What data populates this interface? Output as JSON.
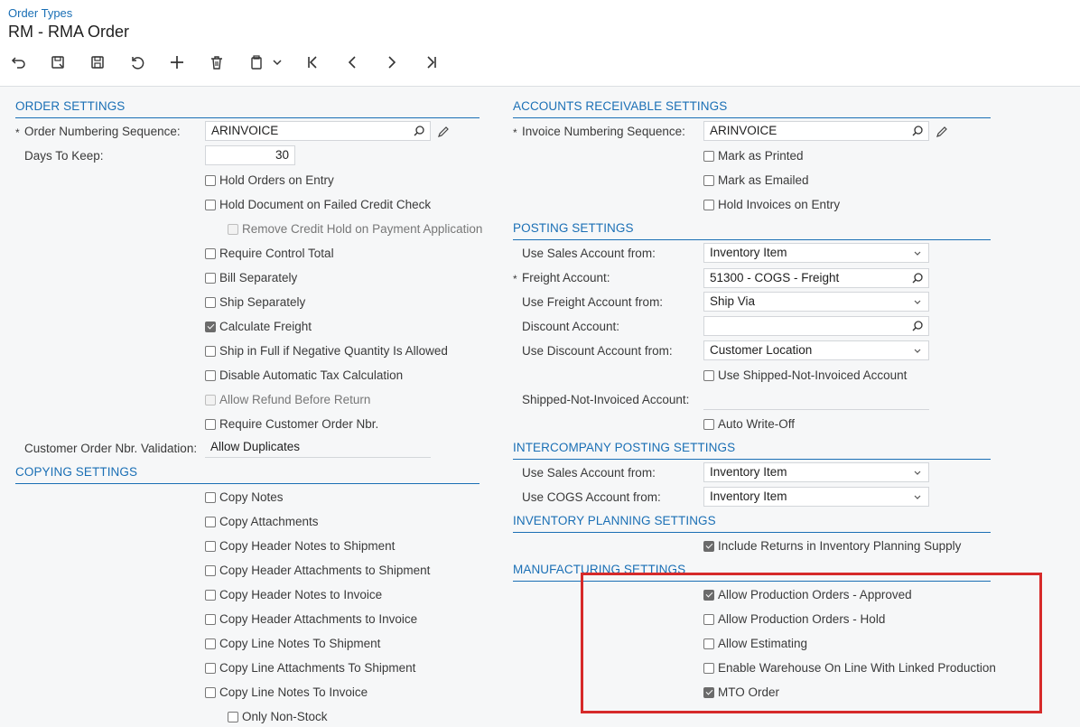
{
  "header": {
    "breadcrumb": "Order Types",
    "title": "RM - RMA Order"
  },
  "toolbar": {
    "icons": [
      "back-icon",
      "save-close-icon",
      "save-icon",
      "undo-icon",
      "add-icon",
      "delete-icon",
      "copy-paste-icon",
      "chevron-down-icon",
      "first-icon",
      "previous-icon",
      "next-icon",
      "last-icon"
    ]
  },
  "order_settings": {
    "header": "ORDER SETTINGS",
    "numbering_label": "Order Numbering Sequence:",
    "numbering_value": "ARINVOICE",
    "days_label": "Days To Keep:",
    "days_value": "30",
    "checks": [
      {
        "label": "Hold Orders on Entry",
        "checked": false
      },
      {
        "label": "Hold Document on Failed Credit Check",
        "checked": false
      },
      {
        "label": "Remove Credit Hold on Payment Application",
        "checked": false,
        "disabled": true
      },
      {
        "label": "Require Control Total",
        "checked": false
      },
      {
        "label": "Bill Separately",
        "checked": false
      },
      {
        "label": "Ship Separately",
        "checked": false
      },
      {
        "label": "Calculate Freight",
        "checked": true
      },
      {
        "label": "Ship in Full if Negative Quantity Is Allowed",
        "checked": false
      },
      {
        "label": "Disable Automatic Tax Calculation",
        "checked": false
      },
      {
        "label": "Allow Refund Before Return",
        "checked": false,
        "disabled": true
      },
      {
        "label": "Require Customer Order Nbr.",
        "checked": false
      }
    ],
    "validation_label": "Customer Order Nbr. Validation:",
    "validation_value": "Allow Duplicates"
  },
  "copying_settings": {
    "header": "COPYING SETTINGS",
    "checks": [
      {
        "label": "Copy Notes",
        "checked": false
      },
      {
        "label": "Copy Attachments",
        "checked": false
      },
      {
        "label": "Copy Header Notes to Shipment",
        "checked": false
      },
      {
        "label": "Copy Header Attachments to Shipment",
        "checked": false
      },
      {
        "label": "Copy Header Notes to Invoice",
        "checked": false
      },
      {
        "label": "Copy Header Attachments to Invoice",
        "checked": false
      },
      {
        "label": "Copy Line Notes To Shipment",
        "checked": false
      },
      {
        "label": "Copy Line Attachments To Shipment",
        "checked": false
      },
      {
        "label": "Copy Line Notes To Invoice",
        "checked": false
      },
      {
        "label": "Only Non-Stock",
        "checked": false
      }
    ]
  },
  "ar_settings": {
    "header": "ACCOUNTS RECEIVABLE SETTINGS",
    "numbering_label": "Invoice Numbering Sequence:",
    "numbering_value": "ARINVOICE",
    "checks": [
      {
        "label": "Mark as Printed",
        "checked": false
      },
      {
        "label": "Mark as Emailed",
        "checked": false
      },
      {
        "label": "Hold Invoices on Entry",
        "checked": false
      }
    ]
  },
  "posting_settings": {
    "header": "POSTING SETTINGS",
    "sales_from_label": "Use Sales Account from:",
    "sales_from_value": "Inventory Item",
    "freight_account_label": "Freight Account:",
    "freight_account_value": "51300 - COGS - Freight",
    "freight_from_label": "Use Freight Account from:",
    "freight_from_value": "Ship Via",
    "discount_account_label": "Discount Account:",
    "discount_account_value": "",
    "discount_from_label": "Use Discount Account from:",
    "discount_from_value": "Customer Location",
    "use_sni_label": "Use Shipped-Not-Invoiced Account",
    "sni_account_label": "Shipped-Not-Invoiced Account:",
    "auto_writeoff_label": "Auto Write-Off"
  },
  "intercompany_settings": {
    "header": "INTERCOMPANY POSTING SETTINGS",
    "sales_from_label": "Use Sales Account from:",
    "sales_from_value": "Inventory Item",
    "cogs_from_label": "Use COGS Account from:",
    "cogs_from_value": "Inventory Item"
  },
  "inventory_planning": {
    "header": "INVENTORY PLANNING SETTINGS",
    "include_returns_label": "Include Returns in Inventory Planning Supply",
    "include_returns_checked": true
  },
  "manufacturing_settings": {
    "header": "MANUFACTURING SETTINGS",
    "checks": [
      {
        "label": "Allow Production Orders - Approved",
        "checked": true
      },
      {
        "label": "Allow Production Orders - Hold",
        "checked": false
      },
      {
        "label": "Allow Estimating",
        "checked": false
      },
      {
        "label": "Enable Warehouse On Line With Linked Production",
        "checked": false
      },
      {
        "label": "MTO Order",
        "checked": true
      }
    ]
  },
  "highlight_color": "#d62a2a",
  "accent_color": "#1a6fb5"
}
